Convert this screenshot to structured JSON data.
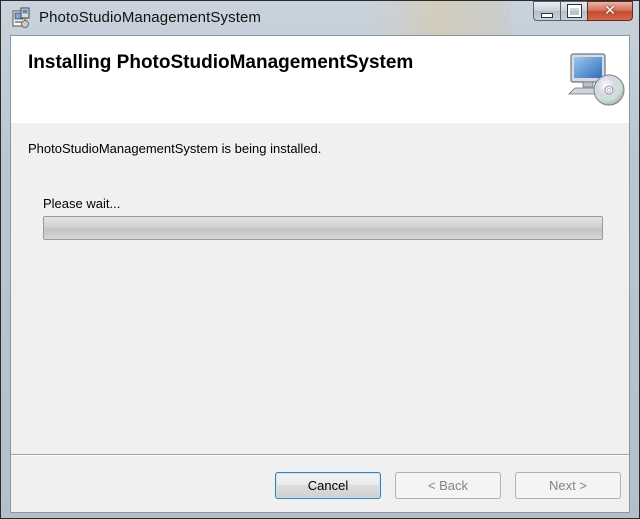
{
  "window": {
    "title": "PhotoStudioManagementSystem",
    "close_glyph": "✕"
  },
  "banner": {
    "heading": "Installing PhotoStudioManagementSystem",
    "icon": "computer-cd-icon"
  },
  "status": {
    "message": "PhotoStudioManagementSystem is being installed.",
    "wait_label": "Please wait...",
    "progress_fraction": 0
  },
  "buttons": {
    "cancel": "Cancel",
    "back": "< Back",
    "next": "Next >"
  },
  "colors": {
    "client_bg": "#f0f0f0",
    "banner_bg": "#ffffff",
    "close_button": "#c44b2e",
    "default_button_border": "#3c7fb1"
  }
}
